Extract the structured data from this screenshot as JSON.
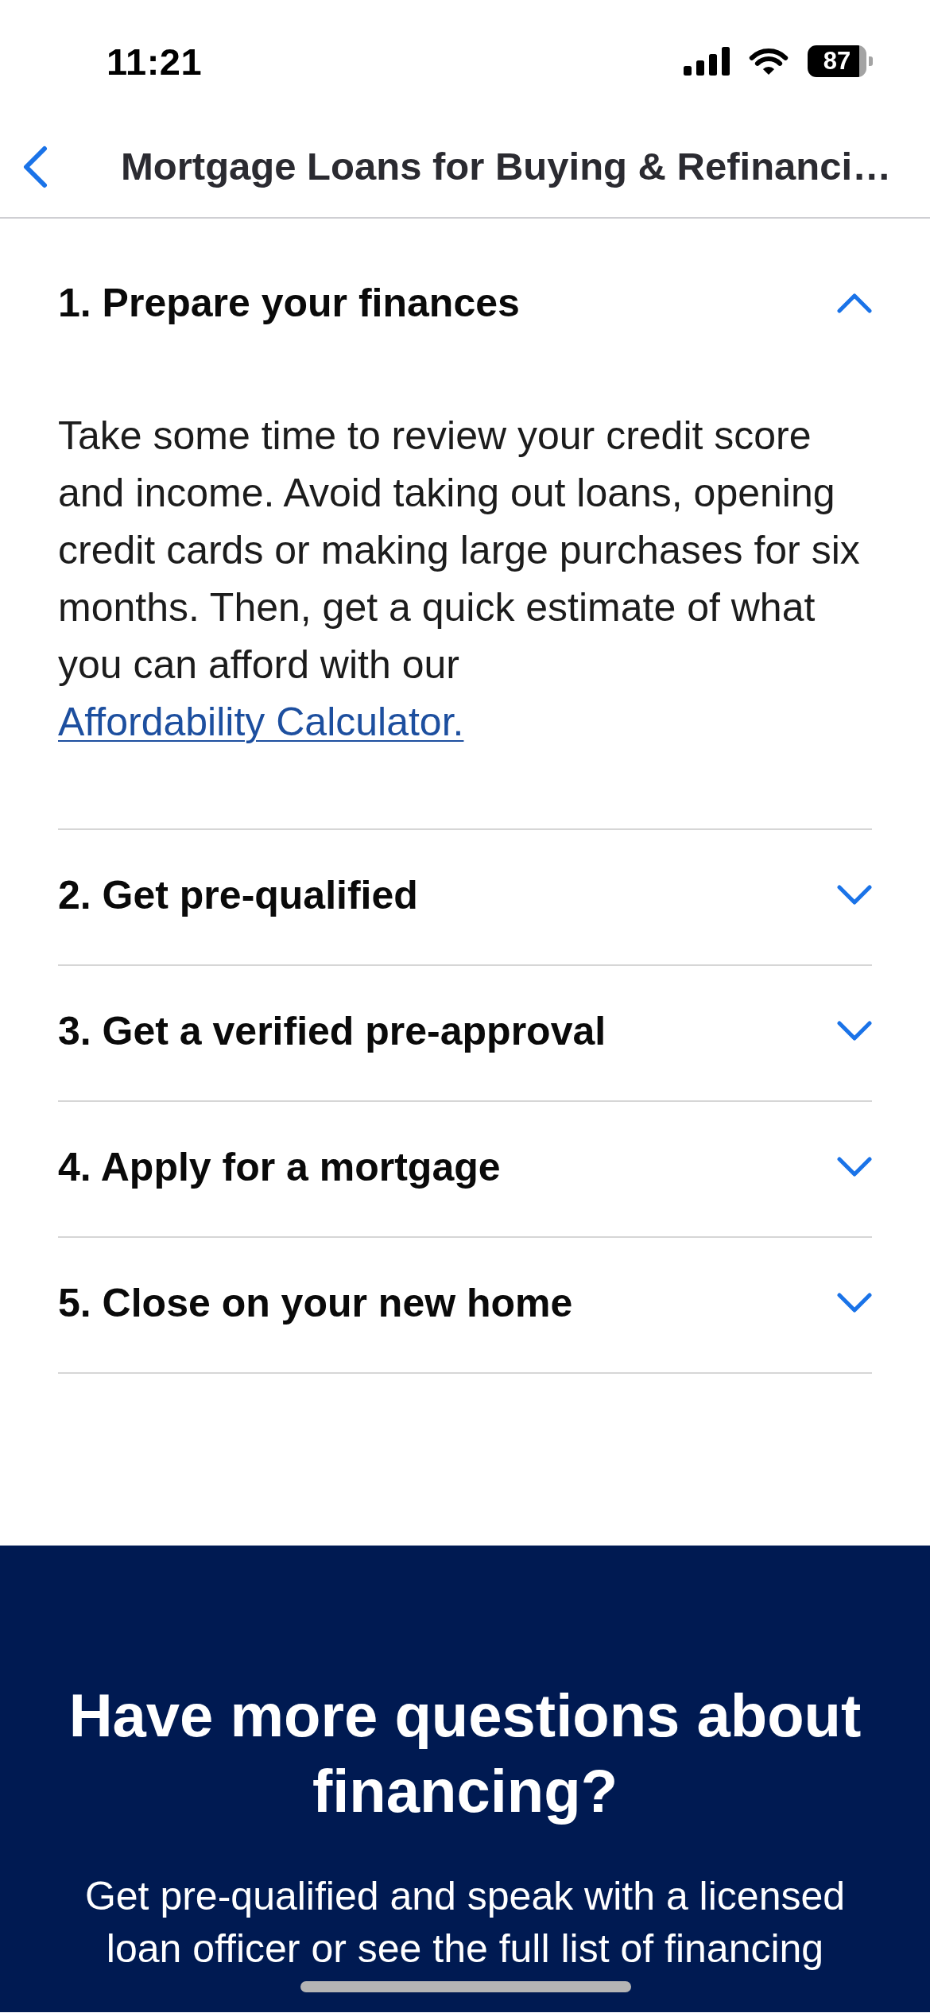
{
  "status_bar": {
    "time": "11:21",
    "battery": "87"
  },
  "nav_bar": {
    "title": "Mortgage Loans for Buying & Refinanci…"
  },
  "steps": [
    {
      "title": "1. Prepare your finances",
      "expanded": true,
      "body": "Take some time to review your credit score and income. Avoid taking out loans, opening credit cards or making large purchases for six months. Then, get a quick estimate of what you can afford with our",
      "link": "Affordability Calculator."
    },
    {
      "title": "2. Get pre-qualified",
      "expanded": false
    },
    {
      "title": "3. Get a verified pre-approval",
      "expanded": false
    },
    {
      "title": "4. Apply for a mortgage",
      "expanded": false
    },
    {
      "title": "5. Close on your new home",
      "expanded": false
    }
  ],
  "cta": {
    "heading": "Have more questions about financing?",
    "text": "Get pre-qualified and speak with a licensed loan officer or see the full list of financing"
  }
}
